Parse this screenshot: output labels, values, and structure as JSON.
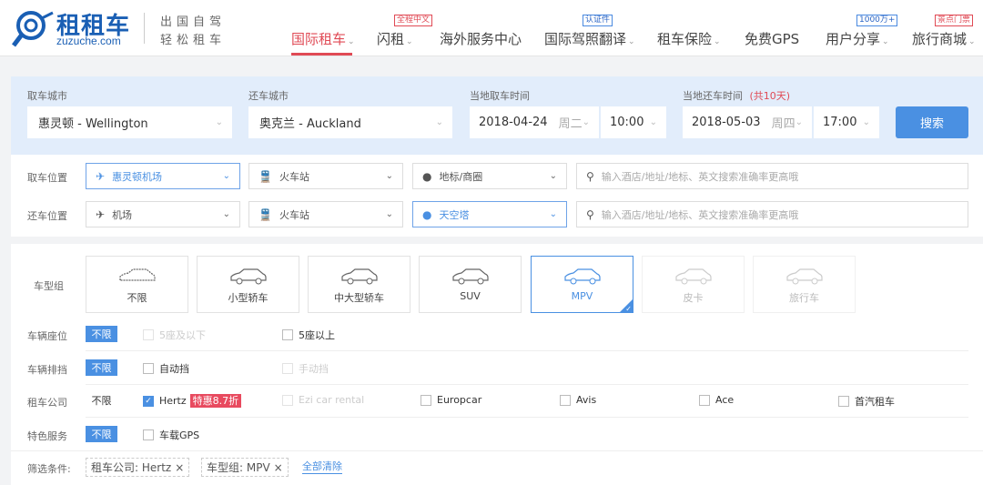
{
  "header": {
    "logo_text": "租租车",
    "logo_domain": "zuzuche.com",
    "tagline_1": "出国自驾",
    "tagline_2": "轻松租车",
    "nav": [
      {
        "label": "国际租车",
        "active": true,
        "has_dropdown": true
      },
      {
        "label": "闪租",
        "badge": "全程中文",
        "has_dropdown": true
      },
      {
        "label": "海外服务中心"
      },
      {
        "label": "国际驾照翻译",
        "badge": "认证件",
        "has_dropdown": true
      },
      {
        "label": "租车保险",
        "has_dropdown": true
      },
      {
        "label": "免费GPS"
      },
      {
        "label": "用户分享",
        "badge": "1000万+",
        "has_dropdown": true
      },
      {
        "label": "旅行商城",
        "badge": "景点门票",
        "has_dropdown": true
      }
    ]
  },
  "search": {
    "pickup_city_label": "取车城市",
    "pickup_city": "惠灵顿 - Wellington",
    "return_city_label": "还车城市",
    "return_city": "奥克兰 - Auckland",
    "pickup_time_label": "当地取车时间",
    "pickup_date": "2018-04-24",
    "pickup_weekday": "周二",
    "pickup_time": "10:00",
    "return_time_label": "当地还车时间",
    "duration": "(共10天)",
    "return_date": "2018-05-03",
    "return_weekday": "周四",
    "return_time": "17:00",
    "search_button": "搜索"
  },
  "locations": {
    "pickup_label": "取车位置",
    "return_label": "还车位置",
    "pickup": [
      "惠灵顿机场",
      "火车站",
      "地标/商圈"
    ],
    "return": [
      "机场",
      "火车站",
      "天空塔"
    ],
    "search_placeholder": "输入酒店/地址/地标、英文搜索准确率更高哦"
  },
  "filters": {
    "car_type_label": "车型组",
    "car_types": [
      "不限",
      "小型轿车",
      "中大型轿车",
      "SUV",
      "MPV",
      "皮卡",
      "旅行车"
    ],
    "any_label": "不限",
    "seats_label": "车辆座位",
    "seats": [
      "5座及以下",
      "5座以上"
    ],
    "transmission_label": "车辆排挡",
    "transmission": [
      "自动挡",
      "手动挡"
    ],
    "company_label": "租车公司",
    "companies": [
      "Hertz",
      "Ezi car rental",
      "Europcar",
      "Avis",
      "Ace",
      "首汽租车"
    ],
    "hertz_promo": "特惠8.7折",
    "services_label": "特色服务",
    "services": [
      "车载GPS"
    ],
    "conditions_label": "筛选条件:",
    "chips": [
      "租车公司: Hertz",
      "车型组: MPV"
    ],
    "clear_all": "全部清除"
  },
  "colors": {
    "accent": "#4a90e2",
    "active_nav": "#e04a55",
    "panel": "#e2edfb"
  }
}
